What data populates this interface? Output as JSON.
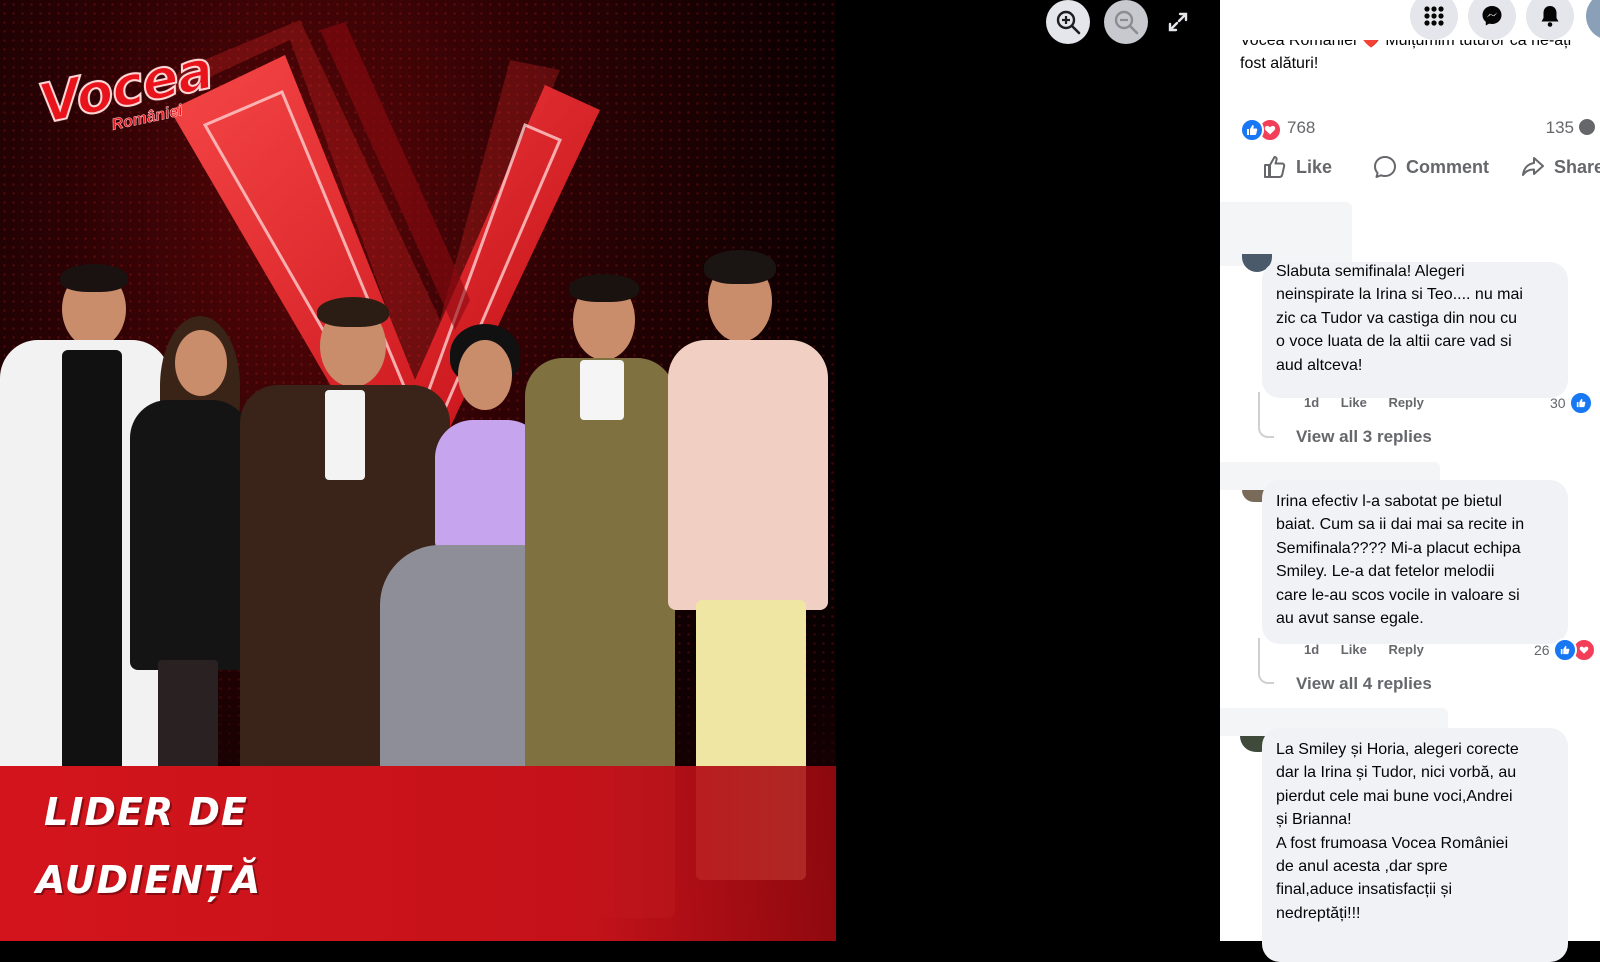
{
  "viewer": {
    "logo_text": "Vocea",
    "logo_sub": "României",
    "banner_line1": "LIDER DE",
    "banner_line2": "AUDIENȚĂ",
    "controls": [
      "zoom-in-icon",
      "zoom-out-icon",
      "fullscreen-icon"
    ]
  },
  "top_nav": {
    "icons": [
      "apps-grid-icon",
      "messenger-icon",
      "notifications-bell-icon",
      "profile-avatar"
    ]
  },
  "post": {
    "caption_clipped": "Vocea României ❤️ Mulțumim tuturor că ne-ați",
    "caption_line2": "fost alături!",
    "reaction_count": "768",
    "comment_count": "135",
    "actions": {
      "like": "Like",
      "comment": "Comment",
      "share": "Share"
    }
  },
  "comments": [
    {
      "text": "Slabuta semifinala! Alegeri\nneinspirate la Irina si Teo.... nu mai\nzic ca Tudor va castiga din nou cu\no voce luata de la altii care vad si\naud altceva!",
      "age": "1d",
      "like": "Like",
      "reply": "Reply",
      "reactions": "30",
      "view_replies": "View all 3 replies"
    },
    {
      "text": "Irina efectiv l-a sabotat pe bietul\nbaiat. Cum sa ii dai mai sa recite in\nSemifinala???? Mi-a placut echipa\nSmiley. Le-a dat fetelor melodii\ncare le-au scos vocile in valoare si\nau avut sanse egale.",
      "age": "1d",
      "like": "Like",
      "reply": "Reply",
      "reactions": "26",
      "view_replies": "View all 4 replies"
    },
    {
      "text": "La Smiley și Horia, alegeri corecte\ndar la Irina și Tudor, nici vorbă, au\npierdut cele mai bune voci,Andrei\nși Brianna!\nA fost frumoasa Vocea României\nde anul acesta ,dar spre\nfinal,aduce insatisfacții și\nnedreptăți!!!"
    }
  ],
  "colors": {
    "facebook_blue": "#1877f2",
    "love_red": "#f33e58",
    "banner_red": "#d4141c",
    "bubble_gray": "#f0f2f5"
  }
}
